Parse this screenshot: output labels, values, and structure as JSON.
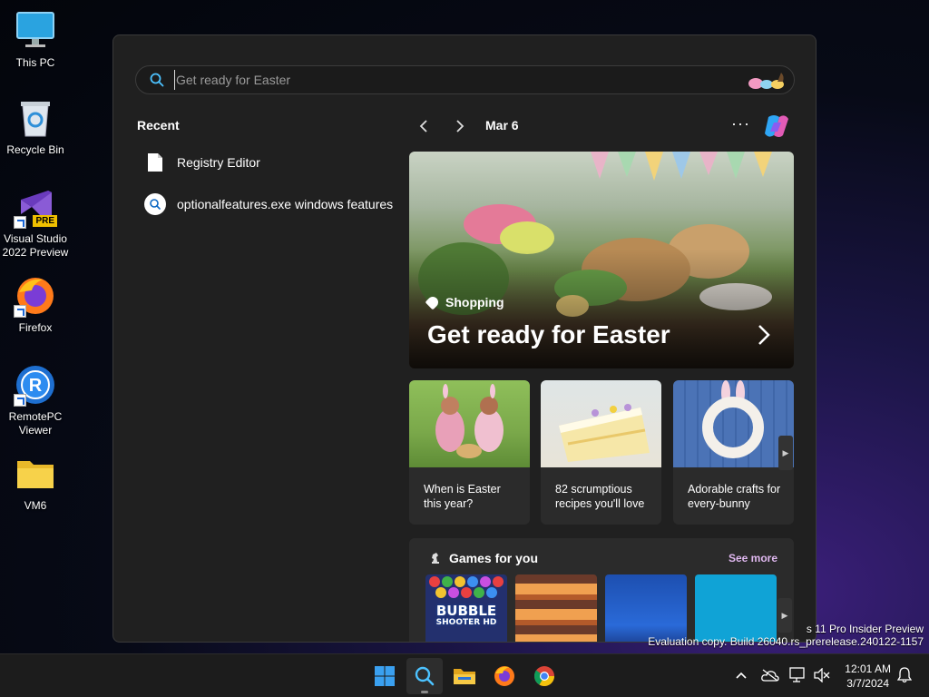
{
  "desktop": {
    "icons": [
      {
        "label": "This PC",
        "icon": "monitor-icon"
      },
      {
        "label": "Recycle Bin",
        "icon": "recycle-bin-icon"
      },
      {
        "label": "Visual Studio\n2022 Preview",
        "icon": "visual-studio-icon",
        "badge": "PRE"
      },
      {
        "label": "Firefox",
        "icon": "firefox-icon"
      },
      {
        "label": "RemotePC\nViewer",
        "icon": "remotepc-icon"
      },
      {
        "label": "VM6",
        "icon": "folder-icon"
      }
    ]
  },
  "search": {
    "placeholder": "Get ready for Easter",
    "value": ""
  },
  "recent": {
    "title": "Recent",
    "items": [
      {
        "label": "Registry Editor",
        "icon": "file-icon"
      },
      {
        "label": "optionalfeatures.exe windows features",
        "icon": "search-icon"
      }
    ]
  },
  "nav": {
    "date": "Mar 6",
    "more": "···"
  },
  "hero": {
    "category": "Shopping",
    "title": "Get ready for Easter"
  },
  "cards": [
    {
      "text": "When is Easter this year?"
    },
    {
      "text": "82 scrumptious recipes you'll love"
    },
    {
      "text": "Adorable crafts for every-bunny"
    }
  ],
  "games": {
    "title": "Games for you",
    "see_more": "See more",
    "tiles": [
      {
        "name": "Bubble Shooter HD",
        "line1": "BUBBLE",
        "line2": "SHOOTER HD"
      },
      {
        "name": "game-tile-2"
      },
      {
        "name": "game-tile-3"
      },
      {
        "name": "game-tile-4"
      }
    ]
  },
  "watermark": {
    "line1": "s 11 Pro Insider Preview",
    "line2": "Evaluation copy. Build 26040.rs_prerelease.240122-1157"
  },
  "taskbar": {
    "apps": [
      "start-button",
      "search-button",
      "file-explorer-button",
      "firefox-button",
      "chrome-button"
    ],
    "time": "12:01 AM",
    "date": "3/7/2024"
  },
  "colors": {
    "flyout_bg": "#202020",
    "card_bg": "#2b2b2b",
    "accent_link": "#e0b8f0",
    "taskbar_bg": "#1c1c1c"
  }
}
